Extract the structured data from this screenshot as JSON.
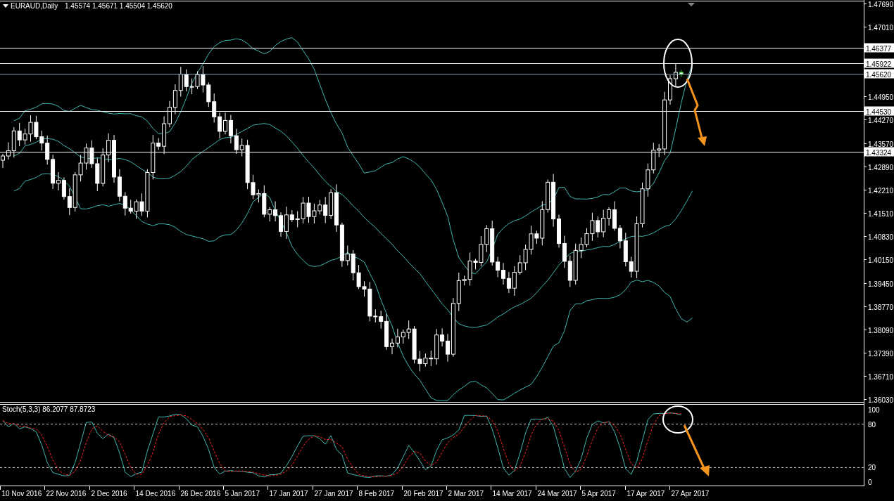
{
  "title": {
    "symbol": "EURAUD,Daily",
    "ohlc": "1.45574 1.45671 1.45504 1.45620"
  },
  "price_axis": {
    "labels": [
      "1.47690",
      "1.47010",
      "1.44950",
      "1.44270",
      "1.43570",
      "1.42890",
      "1.42210",
      "1.41510",
      "1.40830",
      "1.40150",
      "1.39450",
      "1.38770",
      "1.38090",
      "1.37390",
      "1.36710",
      "1.36030"
    ]
  },
  "level_lines": [
    {
      "label": "1.46377",
      "kind": "level"
    },
    {
      "label": "1.45922",
      "kind": "level"
    },
    {
      "label": "1.45620",
      "kind": "bid"
    },
    {
      "label": "1.44530",
      "kind": "level"
    },
    {
      "label": "1.43324",
      "kind": "level"
    }
  ],
  "indicator": {
    "label": "Stoch(5,3,3) 86.2077 87.8723",
    "axis_labels": [
      "100",
      "80",
      "20",
      "0"
    ]
  },
  "time_axis": {
    "labels": [
      "10 Nov 2016",
      "22 Nov 2016",
      "2 Dec 2016",
      "14 Dec 2016",
      "26 Dec 2016",
      "5 Jan 2017",
      "17 Jan 2017",
      "27 Jan 2017",
      "8 Feb 2017",
      "20 Feb 2017",
      "2 Mar 2017",
      "14 Mar 2017",
      "24 Mar 2017",
      "5 Apr 2017",
      "17 Apr 2017",
      "27 Apr 2017"
    ]
  }
}
